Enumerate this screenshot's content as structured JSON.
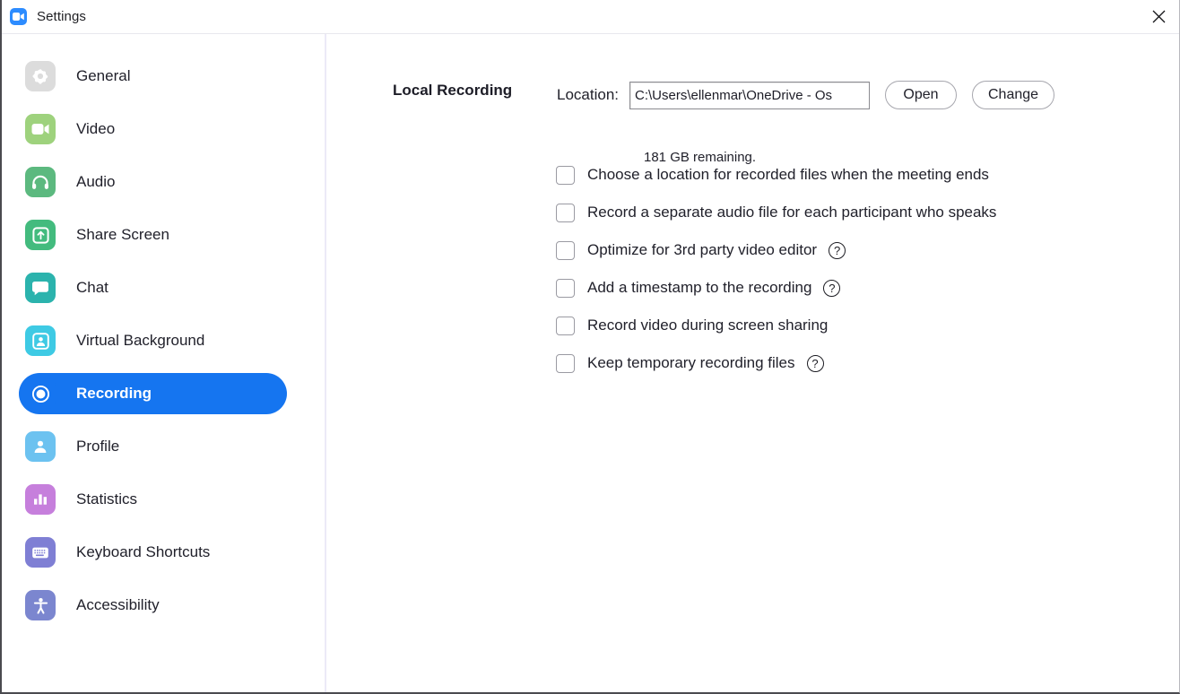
{
  "window": {
    "title": "Settings",
    "app_icon": "zoom-camera-icon",
    "close_icon": "close-icon",
    "accent_color": "#1575f0"
  },
  "sidebar": {
    "items": [
      {
        "label": "General",
        "icon": "gear-icon",
        "color": "#dcdcdc",
        "active": false
      },
      {
        "label": "Video",
        "icon": "video-camera-icon",
        "color": "#9ed27d",
        "active": false
      },
      {
        "label": "Audio",
        "icon": "headphones-icon",
        "color": "#5cb97f",
        "active": false
      },
      {
        "label": "Share Screen",
        "icon": "share-screen-icon",
        "color": "#43bb7e",
        "active": false
      },
      {
        "label": "Chat",
        "icon": "chat-bubble-icon",
        "color": "#2bb3ad",
        "active": false
      },
      {
        "label": "Virtual Background",
        "icon": "person-frame-icon",
        "color": "#3ecae4",
        "active": false
      },
      {
        "label": "Recording",
        "icon": "record-circle-icon",
        "color": "#1575f0",
        "active": true
      },
      {
        "label": "Profile",
        "icon": "person-icon",
        "color": "#6cc2f0",
        "active": false
      },
      {
        "label": "Statistics",
        "icon": "bar-chart-icon",
        "color": "#c67fdc",
        "active": false
      },
      {
        "label": "Keyboard Shortcuts",
        "icon": "keyboard-icon",
        "color": "#7f7fd4",
        "active": false
      },
      {
        "label": "Accessibility",
        "icon": "accessibility-icon",
        "color": "#7b86cf",
        "active": false
      }
    ]
  },
  "main": {
    "section_title": "Local Recording",
    "location": {
      "label": "Location:",
      "value": "C:\\Users\\ellenmar\\OneDrive - Os",
      "placeholder": "",
      "open_label": "Open",
      "change_label": "Change"
    },
    "remaining_text": "181 GB remaining.",
    "options": [
      {
        "label": "Choose a location for recorded files when the meeting ends",
        "checked": false,
        "help": false
      },
      {
        "label": "Record a separate audio file for each participant who speaks",
        "checked": false,
        "help": false
      },
      {
        "label": "Optimize for 3rd party video editor",
        "checked": false,
        "help": true
      },
      {
        "label": "Add a timestamp to the recording",
        "checked": false,
        "help": true
      },
      {
        "label": "Record video during screen sharing",
        "checked": false,
        "help": false
      },
      {
        "label": "Keep temporary recording files",
        "checked": false,
        "help": true
      }
    ],
    "help_glyph": "?"
  }
}
